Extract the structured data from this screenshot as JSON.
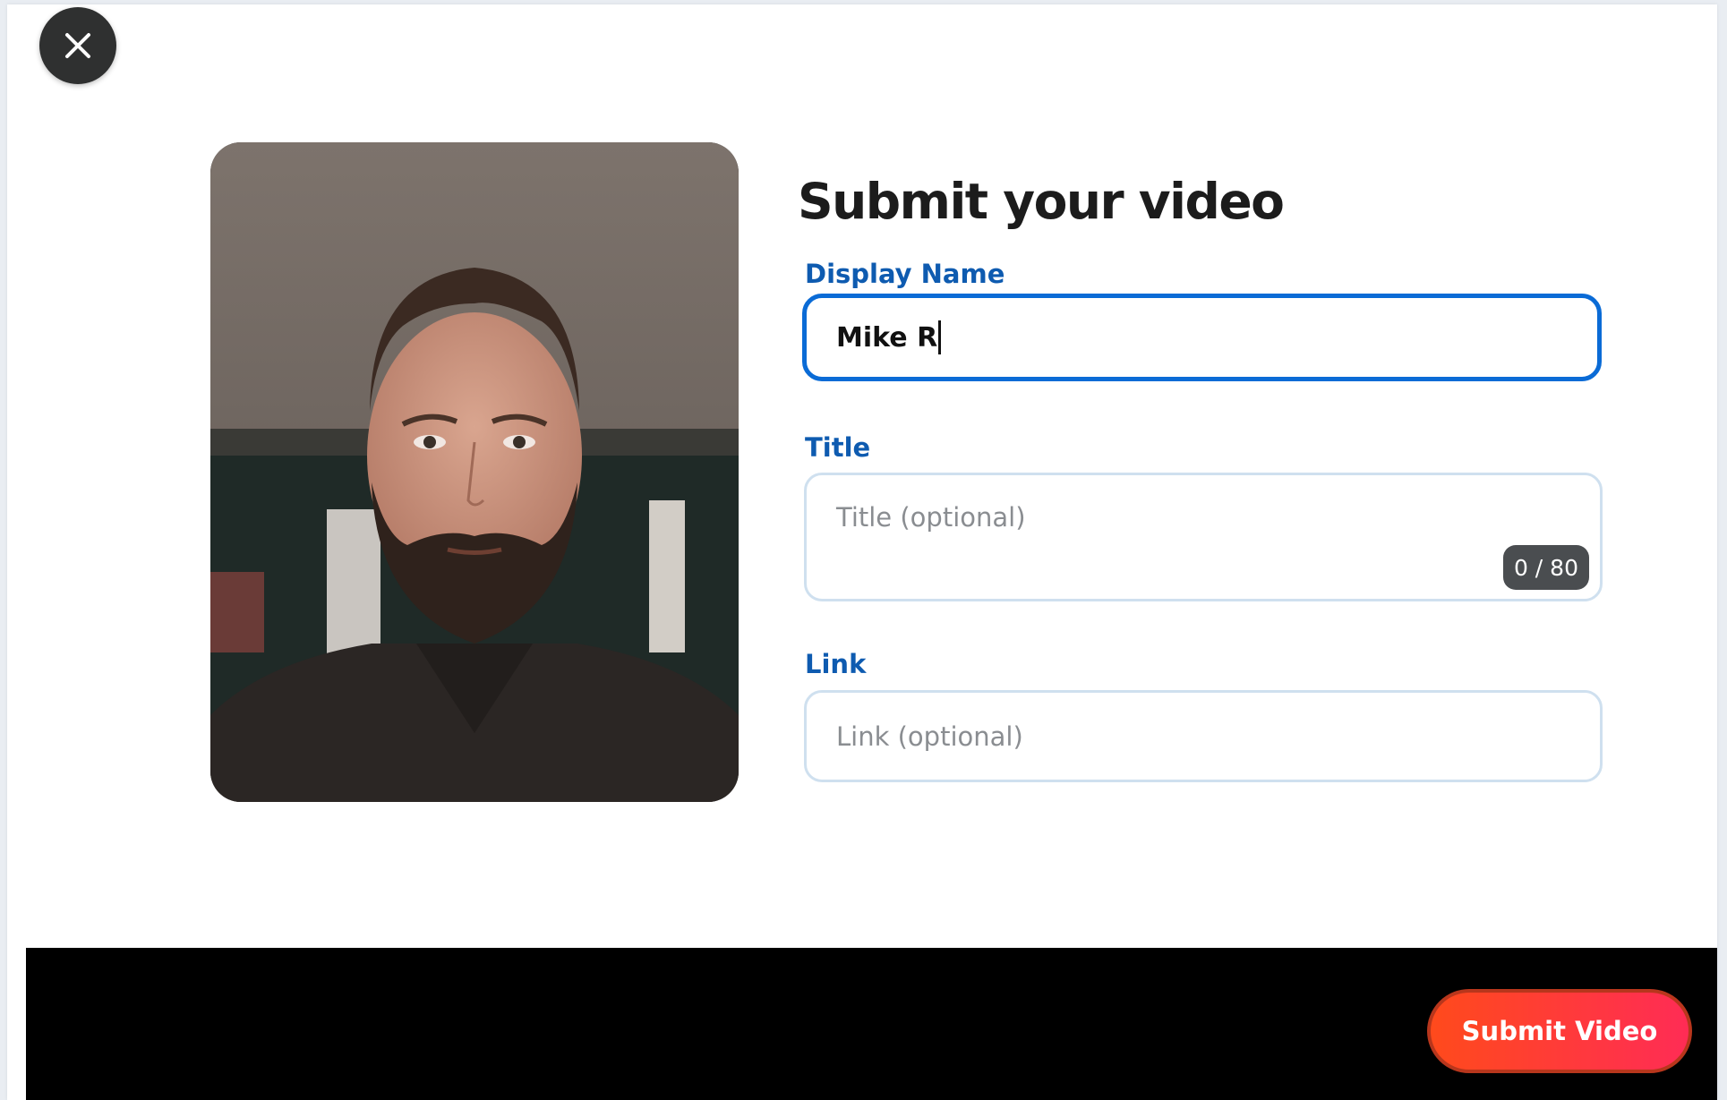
{
  "modal": {
    "heading": "Submit your video"
  },
  "fields": {
    "display_name": {
      "label": "Display Name",
      "value": "Mike R"
    },
    "title": {
      "label": "Title",
      "placeholder": "Title (optional)",
      "counter": "0 / 80"
    },
    "link": {
      "label": "Link",
      "placeholder": "Link (optional)"
    }
  },
  "footer": {
    "submit_label": "Submit Video"
  },
  "icons": {
    "close": "close-icon"
  },
  "colors": {
    "label_blue": "#0e5bb0",
    "focus_border": "#0a6bd6",
    "submit_gradient_start": "#ff4a1c",
    "submit_gradient_end": "#ff2c55"
  }
}
